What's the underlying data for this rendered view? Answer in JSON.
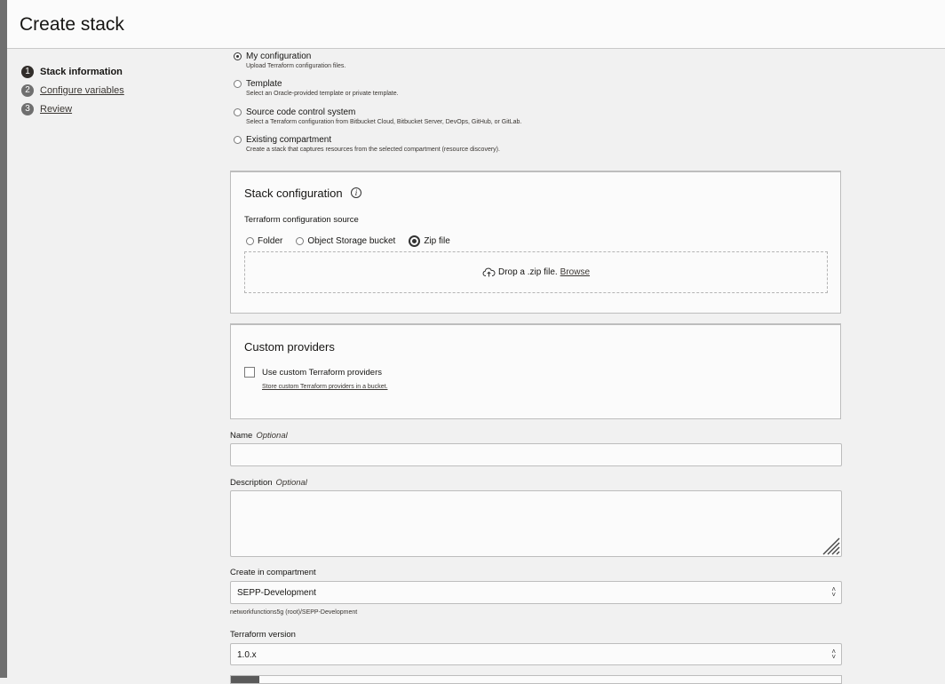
{
  "header": {
    "title": "Create stack"
  },
  "steps": [
    {
      "num": "1",
      "label": "Stack information"
    },
    {
      "num": "2",
      "label": "Configure variables"
    },
    {
      "num": "3",
      "label": "Review"
    }
  ],
  "config_options": [
    {
      "label": "My configuration",
      "desc": "Upload Terraform configuration files."
    },
    {
      "label": "Template",
      "desc": "Select an Oracle-provided template or private template."
    },
    {
      "label": "Source code control system",
      "desc": "Select a Terraform configuration from Bitbucket Cloud, Bitbucket Server, DevOps, GitHub, or GitLab."
    },
    {
      "label": "Existing compartment",
      "desc": "Create a stack that captures resources from the selected compartment (resource discovery)."
    }
  ],
  "stack_config": {
    "title": "Stack configuration",
    "source_label": "Terraform configuration source",
    "sources": [
      "Folder",
      "Object Storage bucket",
      "Zip file"
    ],
    "drop_text": "Drop a .zip file.",
    "browse": "Browse"
  },
  "custom_providers": {
    "title": "Custom providers",
    "checkbox_label": "Use custom Terraform providers",
    "link": "Store custom Terraform providers in a bucket."
  },
  "name_field": {
    "label": "Name",
    "optional": "Optional",
    "value": ""
  },
  "description_field": {
    "label": "Description",
    "optional": "Optional",
    "value": ""
  },
  "compartment": {
    "label": "Create in compartment",
    "value": "SEPP-Development",
    "helper": "networkfunctions5g (root)/SEPP-Development"
  },
  "terraform_version": {
    "label": "Terraform version",
    "value": "1.0.x"
  }
}
